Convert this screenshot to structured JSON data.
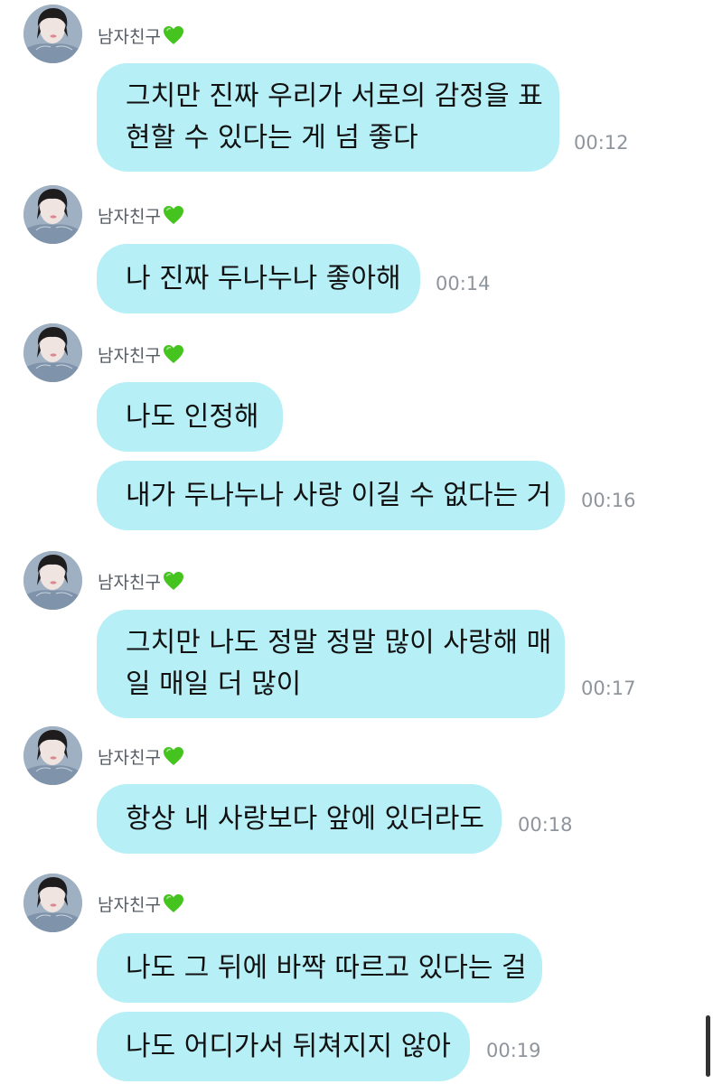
{
  "sender_name": "남자친구",
  "heart_icon": "green-heart-icon",
  "heart_color": "#45c41f",
  "bubble_color": "#b6f0f6",
  "messages": [
    {
      "lines": [
        "그치만 진짜 우리가 서로의 감정을 표",
        "현할 수 있다는 게 넘 좋다"
      ],
      "time": "00:12"
    },
    {
      "lines": [
        "나 진짜 두나누나 좋아해"
      ],
      "time": "00:14"
    },
    {
      "lines": [
        "나도 인정해"
      ]
    },
    {
      "lines": [
        "내가 두나누나 사랑 이길 수 없다는 거"
      ],
      "time": "00:16"
    },
    {
      "lines": [
        "그치만 나도 정말 정말 많이 사랑해 매",
        "일 매일 더 많이"
      ],
      "time": "00:17"
    },
    {
      "lines": [
        "항상 내 사랑보다 앞에 있더라도"
      ],
      "time": "00:18"
    },
    {
      "lines": [
        "나도 그 뒤에 바짝 따르고 있다는 걸"
      ]
    },
    {
      "lines": [
        "나도 어디가서 뒤쳐지지 않아"
      ],
      "time": "00:19"
    }
  ]
}
